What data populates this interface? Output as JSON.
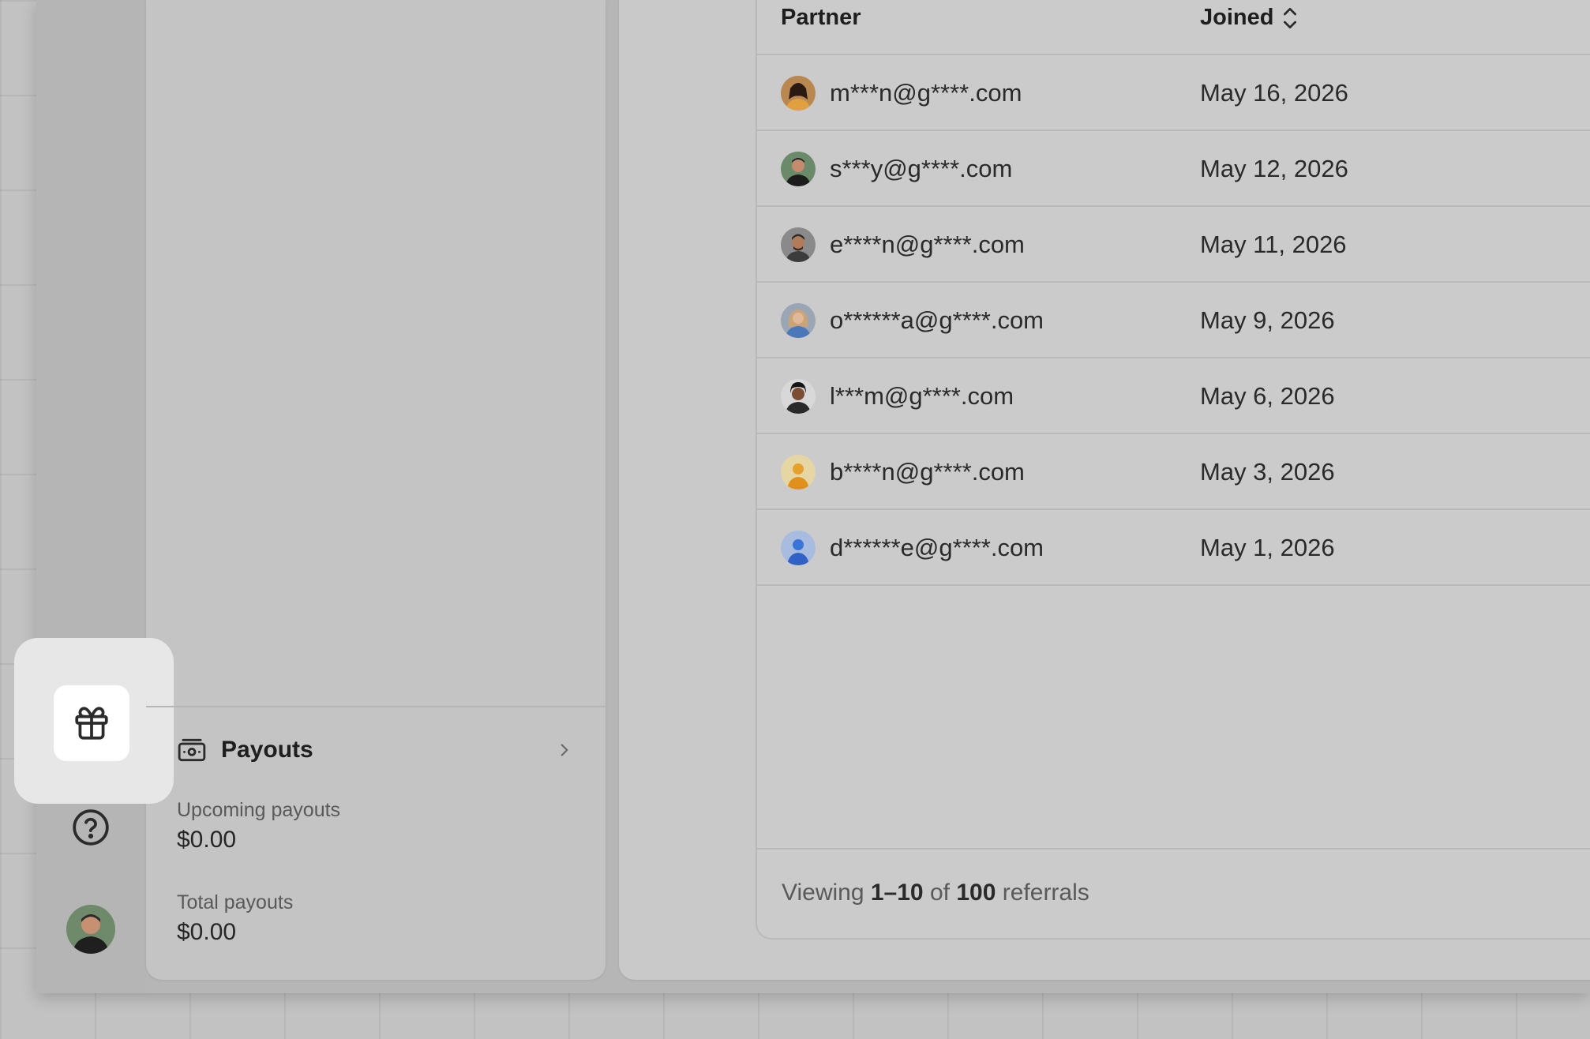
{
  "sidebar": {
    "gift_icon": "gift-icon",
    "help_icon": "help-circle-icon",
    "user_avatar": "user-avatar"
  },
  "payouts": {
    "title": "Payouts",
    "icon": "banknote-icon",
    "upcoming_label": "Upcoming payouts",
    "upcoming_value": "$0.00",
    "total_label": "Total payouts",
    "total_value": "$0.00"
  },
  "table": {
    "columns": {
      "partner": "Partner",
      "joined": "Joined"
    },
    "rows": [
      {
        "email": "m***n@g****.com",
        "joined": "May 16, 2026"
      },
      {
        "email": "s***y@g****.com",
        "joined": "May 12, 2026"
      },
      {
        "email": "e****n@g****.com",
        "joined": "May 11, 2026"
      },
      {
        "email": "o******a@g****.com",
        "joined": "May 9, 2026"
      },
      {
        "email": "l***m@g****.com",
        "joined": "May 6, 2026"
      },
      {
        "email": "b****n@g****.com",
        "joined": "May 3, 2026"
      },
      {
        "email": "d******e@g****.com",
        "joined": "May 1, 2026"
      }
    ],
    "footer": {
      "prefix": "Viewing",
      "range": "1–10",
      "of": "of",
      "total": "100",
      "suffix": "referrals"
    }
  }
}
